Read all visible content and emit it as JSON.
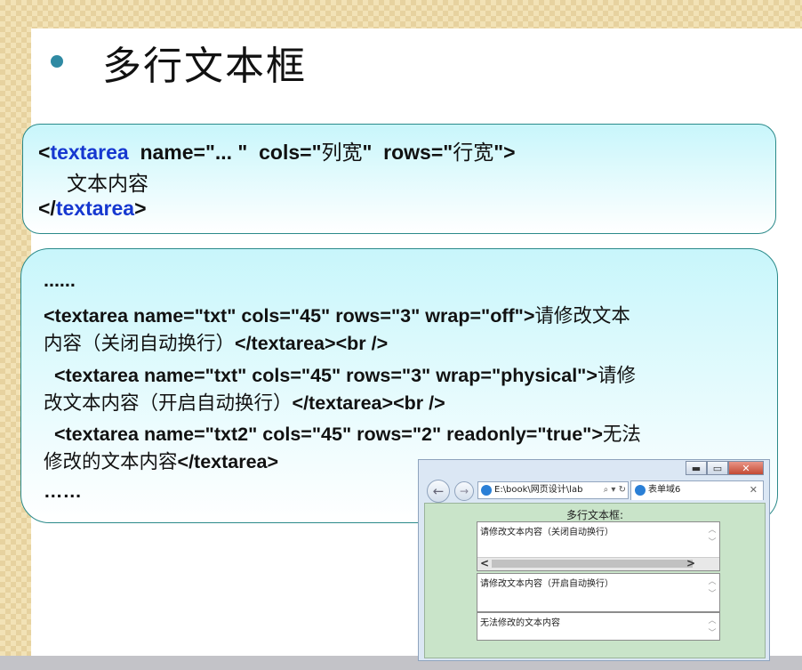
{
  "slide": {
    "title": "多行文本框",
    "syntax": {
      "open_lt": "<",
      "tag": "textarea",
      "attrs_a": "  name=\"... \"  cols=\"",
      "cols_value": "列宽",
      "attrs_b": "\"  rows=\"",
      "rows_value": "行宽",
      "attrs_c": "\">",
      "content": "文本内容",
      "close_lt": "</",
      "close_tag": "textarea",
      "close_gt": ">"
    },
    "example": {
      "line1": "......",
      "line2_code": "<textarea name=\"txt\" cols=\"45\" rows=\"3\" wrap=\"off\">",
      "line2_cn": "请修改文本",
      "line3_cn": "内容（关闭自动换行）",
      "line3_code": "</textarea><br />",
      "line4_code": "  <textarea name=\"txt\" cols=\"45\" rows=\"3\" wrap=\"physical\">",
      "line4_cn": "请修",
      "line5_cn": "改文本内容（开启自动换行）",
      "line5_code": "</textarea><br />",
      "line6_code": "  <textarea name=\"txt2\" cols=\"45\" rows=\"2\" readonly=\"true\">",
      "line6_cn": "无法",
      "line7_cn": "修改的文本内容",
      "line7_code": "</textarea>",
      "line8": "……"
    }
  },
  "browser": {
    "window_controls": {
      "minimize": "▬",
      "maximize": "▭",
      "close": "✕"
    },
    "back": "←",
    "forward": "→",
    "address": "E:\\book\\网页设计\\lab",
    "address_tools": "⌕ ▾ ↻",
    "tab_title": "表单域6",
    "tab_close": "✕",
    "page": {
      "legend": "多行文本框:",
      "textarea1": "请修改文本内容（关闭自动换行）",
      "textarea2": "请修改文本内容（开启自动换行）",
      "textarea3": "无法修改的文本内容",
      "scroll_left": "<",
      "scroll_right": ">",
      "scroll_up": "︿",
      "scroll_down": "﹀"
    }
  },
  "colors": {
    "keyword_blue": "#1638d0",
    "bullet": "#2f8aa3",
    "callout_border": "#2b8a8a",
    "callout_fill_top": "#c8f6fb",
    "browser_page_bg": "#c9e4c9"
  }
}
